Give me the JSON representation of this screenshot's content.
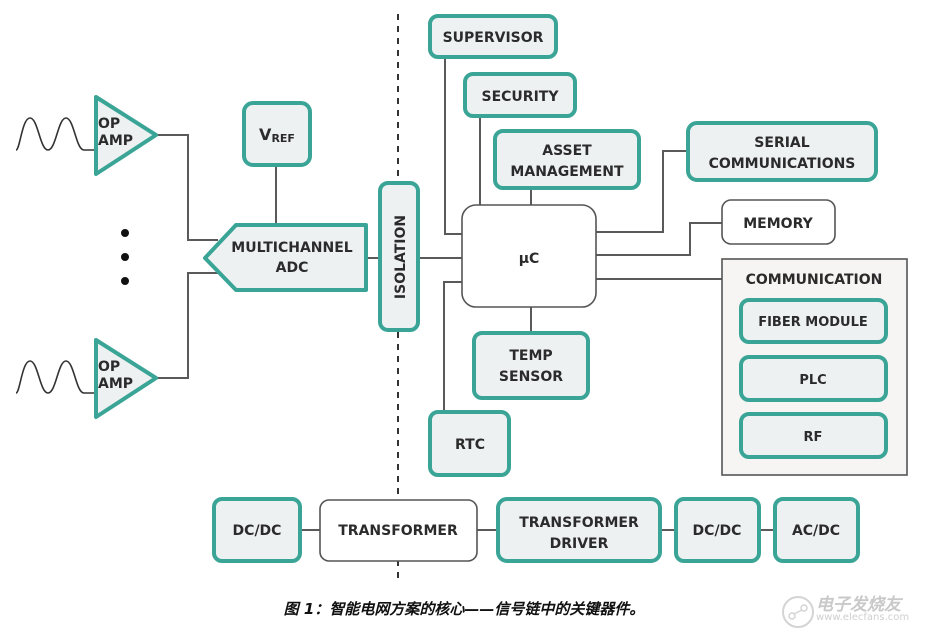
{
  "diagram": {
    "accent_color": "#3aa596",
    "line_color": "#5a5a5a",
    "opamp_top": {
      "line1": "OP",
      "line2": "AMP"
    },
    "opamp_bottom": {
      "line1": "OP",
      "line2": "AMP"
    },
    "vref": {
      "main": "V",
      "sub": "REF"
    },
    "adc": {
      "line1": "MULTICHANNEL",
      "line2": "ADC"
    },
    "isolation": "ISOLATION",
    "supervisor": "SUPERVISOR",
    "security": "SECURITY",
    "asset_management": {
      "line1": "ASSET",
      "line2": "MANAGEMENT"
    },
    "serial_communications": {
      "line1": "SERIAL",
      "line2": "COMMUNICATIONS"
    },
    "memory": "MEMORY",
    "microcontroller": "μC",
    "temp_sensor": {
      "line1": "TEMP",
      "line2": "SENSOR"
    },
    "rtc": "RTC",
    "communication_group": {
      "title": "COMMUNICATION",
      "items": [
        "FIBER MODULE",
        "PLC",
        "RF"
      ]
    },
    "power_chain": {
      "dcdc_left": "DC/DC",
      "transformer": "TRANSFORMER",
      "transformer_driver": {
        "line1": "TRANSFORMER",
        "line2": "DRIVER"
      },
      "dcdc_right": "DC/DC",
      "acdc": "AC/DC"
    }
  },
  "caption": "图 1：智能电网方案的核心——信号链中的关键器件。",
  "watermark": {
    "name": "电子发烧友",
    "url": "www.elecfans.com"
  }
}
